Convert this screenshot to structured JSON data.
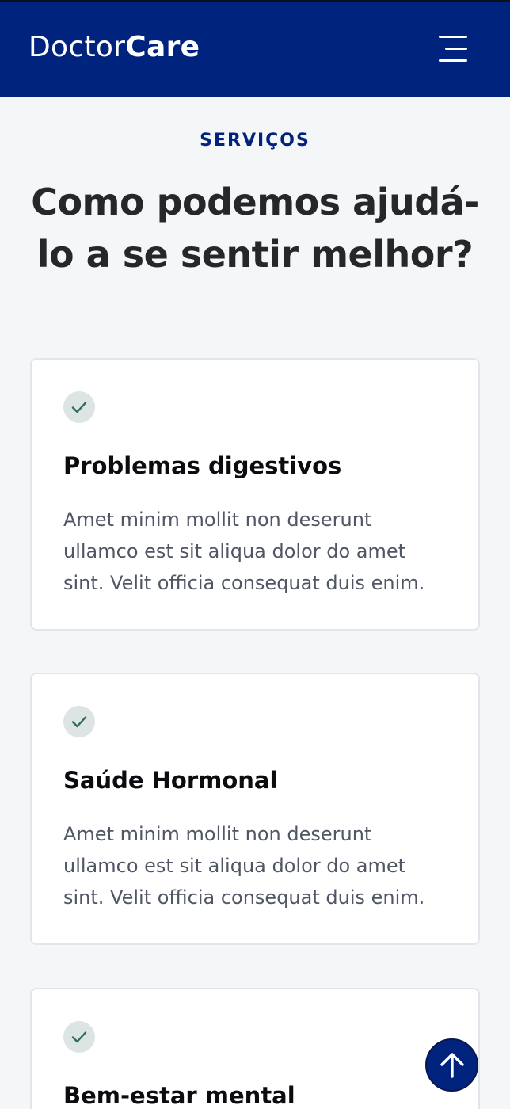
{
  "header": {
    "logo_light": "Doctor",
    "logo_bold": "Care",
    "menu_icon": "hamburger-menu-icon",
    "background_color": "#00247d"
  },
  "services": {
    "eyebrow": "SERVIÇOS",
    "title": "Como podemos ajudá-lo a se sentir melhor?",
    "cards": [
      {
        "icon": "check-icon",
        "title": "Problemas digestivos",
        "text": "Amet minim mollit non deserunt ullamco est sit aliqua dolor do amet sint. Velit officia consequat duis enim."
      },
      {
        "icon": "check-icon",
        "title": "Saúde Hormonal",
        "text": "Amet minim mollit non deserunt ullamco est sit aliqua dolor do amet sint. Velit officia consequat duis enim."
      },
      {
        "icon": "check-icon",
        "title": "Bem-estar mental",
        "text": ""
      }
    ]
  },
  "back_to_top": {
    "icon": "arrow-up-icon"
  },
  "colors": {
    "accent": "#00247d",
    "check_green": "#2e6b58",
    "check_bg": "#dde4e4",
    "page_bg": "#f5f6f8"
  }
}
